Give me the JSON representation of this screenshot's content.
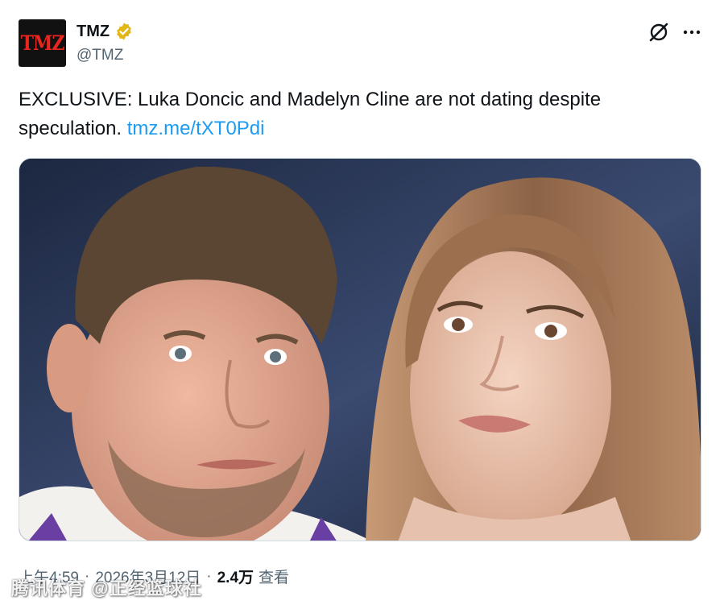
{
  "tweet": {
    "author": {
      "avatar_text": "TMZ",
      "display_name": "TMZ",
      "handle": "@TMZ",
      "verified": true,
      "verified_color": "#e2b719"
    },
    "text_main": "EXCLUSIVE: Luka Doncic and Madelyn Cline are not dating despite speculation.",
    "link_text": "tmz.me/tXT0Pdi",
    "link_color": "#1d9bf0",
    "media": {
      "icon": "photo"
    },
    "meta": {
      "time": "上午4:59",
      "separator": "·",
      "date": "2026年3月12日",
      "views_count": "2.4万",
      "views_label": "查看"
    }
  },
  "actions": {
    "grok_icon": "grok-icon",
    "more_icon": "more-options-icon"
  },
  "watermark": {
    "text": "腾讯体育 @正经篮球社"
  }
}
